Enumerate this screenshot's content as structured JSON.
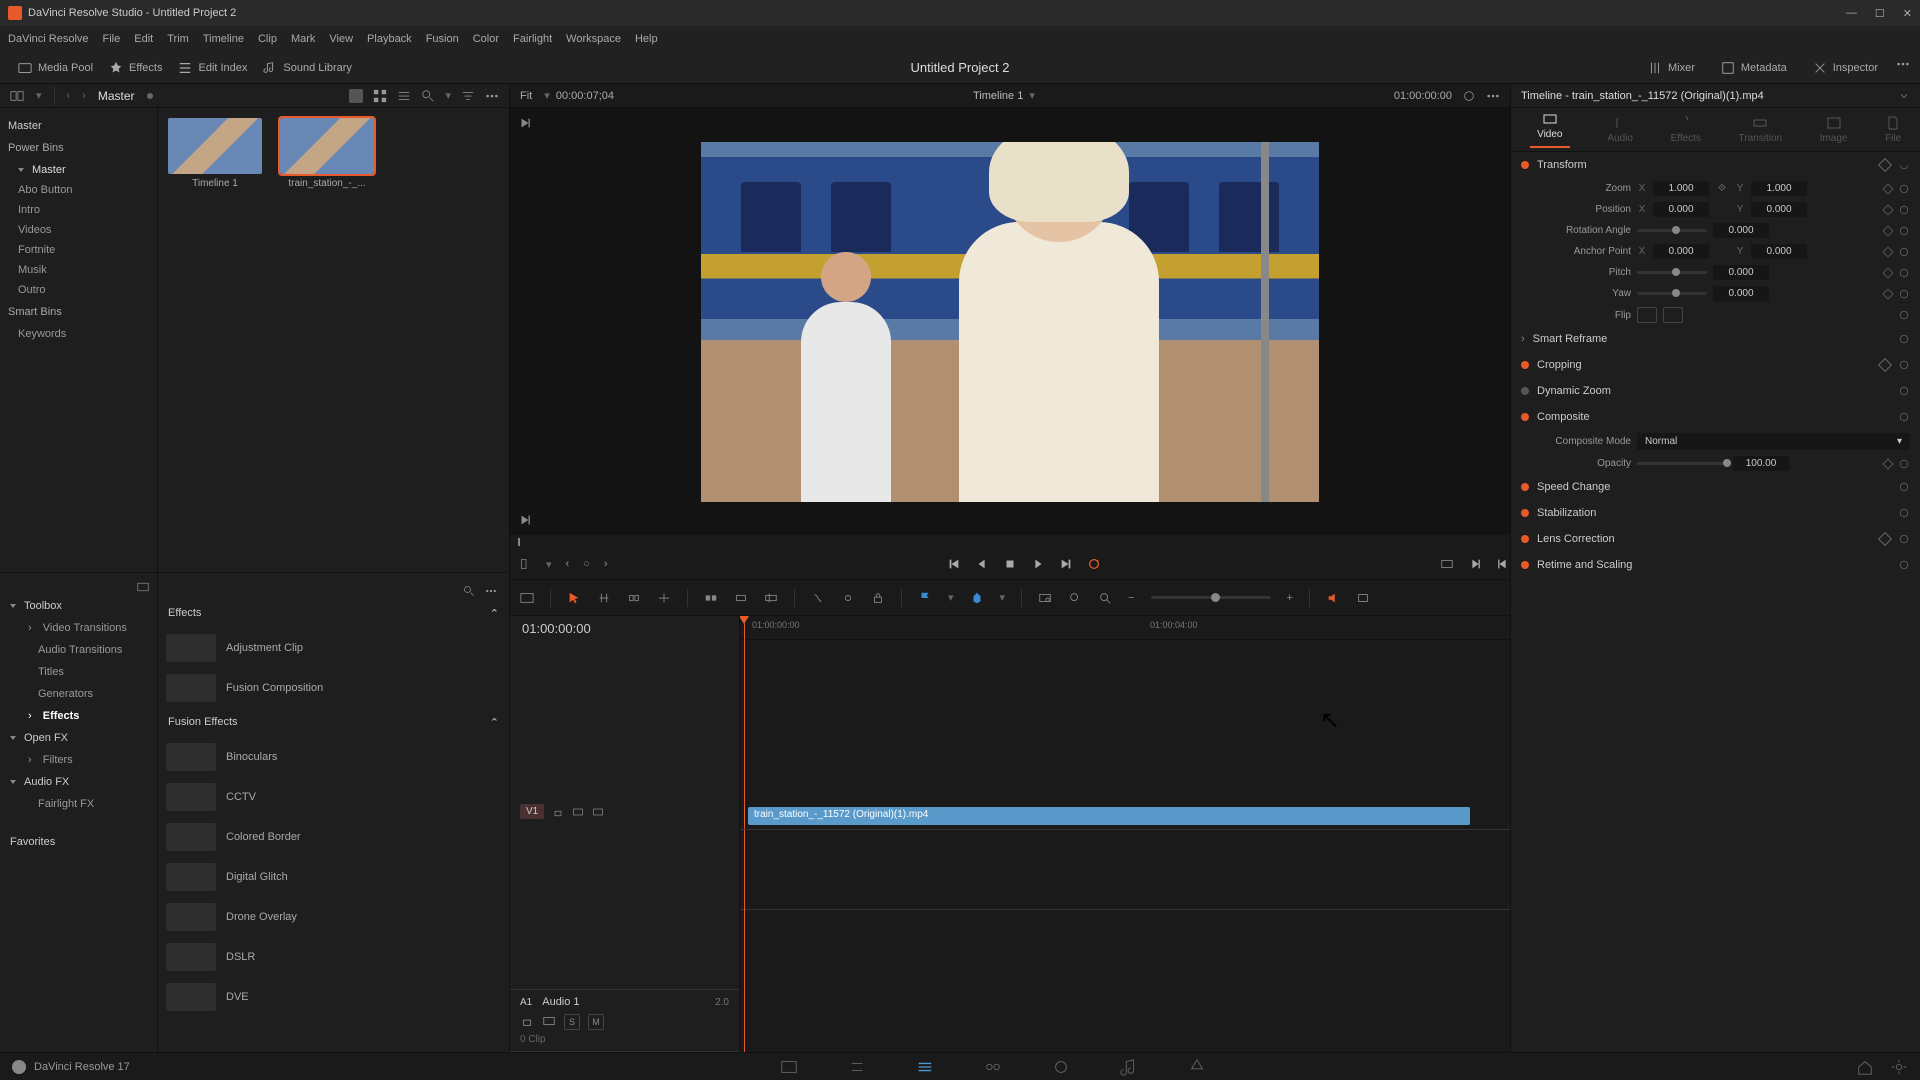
{
  "titlebar": {
    "text": "DaVinci Resolve Studio - Untitled Project 2"
  },
  "menubar": [
    "DaVinci Resolve",
    "File",
    "Edit",
    "Trim",
    "Timeline",
    "Clip",
    "Mark",
    "View",
    "Playback",
    "Fusion",
    "Color",
    "Fairlight",
    "Workspace",
    "Help"
  ],
  "toolbar": {
    "media_pool": "Media Pool",
    "effects": "Effects",
    "edit_index": "Edit Index",
    "sound_library": "Sound Library",
    "mixer": "Mixer",
    "metadata": "Metadata",
    "inspector": "Inspector",
    "project_title": "Untitled Project 2"
  },
  "media": {
    "master": "Master",
    "bins": {
      "master_root": "Master",
      "power_bins": "Power Bins",
      "power_master": "Master",
      "power_items": [
        "Abo Button",
        "Intro",
        "Videos",
        "Fortnite",
        "Musik",
        "Outro"
      ],
      "smart_bins": "Smart Bins",
      "keywords": "Keywords"
    },
    "clips": [
      {
        "name": "Timeline 1",
        "selected": false
      },
      {
        "name": "train_station_-_...",
        "selected": true
      }
    ]
  },
  "fx": {
    "nav": {
      "toolbox": "Toolbox",
      "toolbox_items": [
        "Video Transitions",
        "Audio Transitions",
        "Titles",
        "Generators",
        "Effects"
      ],
      "openfx": "Open FX",
      "openfx_items": [
        "Filters"
      ],
      "audiofx": "Audio FX",
      "audiofx_items": [
        "Fairlight FX"
      ],
      "favorites": "Favorites"
    },
    "groups": {
      "effects": "Effects",
      "effects_items": [
        "Adjustment Clip",
        "Fusion Composition"
      ],
      "fusion": "Fusion Effects",
      "fusion_items": [
        "Binoculars",
        "CCTV",
        "Colored Border",
        "Digital Glitch",
        "Drone Overlay",
        "DSLR",
        "DVE"
      ]
    }
  },
  "viewer": {
    "fit": "Fit",
    "timecode_left": "00:00:07;04",
    "timeline_name": "Timeline 1",
    "timecode_right": "01:00:00:00"
  },
  "timeline": {
    "head_tc": "01:00:00:00",
    "ruler_marks": [
      "01:00:00:00",
      "01:00:04:00"
    ],
    "v1": {
      "label": "V1"
    },
    "a1": {
      "label": "A1",
      "name": "Audio 1",
      "db": "2.0",
      "s": "S",
      "m": "M",
      "clips": "0 Clip"
    },
    "clip_name": "train_station_-_11572 (Original)(1).mp4"
  },
  "inspector": {
    "title": "Timeline - train_station_-_11572 (Original)(1).mp4",
    "tabs": [
      "Video",
      "Audio",
      "Effects",
      "Transition",
      "Image",
      "File"
    ],
    "transform": {
      "head": "Transform",
      "zoom": "Zoom",
      "zoom_x": "1.000",
      "zoom_y": "1.000",
      "position": "Position",
      "pos_x": "0.000",
      "pos_y": "0.000",
      "rotation": "Rotation Angle",
      "rotation_v": "0.000",
      "anchor": "Anchor Point",
      "anchor_x": "0.000",
      "anchor_y": "0.000",
      "pitch": "Pitch",
      "pitch_v": "0.000",
      "yaw": "Yaw",
      "yaw_v": "0.000",
      "flip": "Flip"
    },
    "smart_reframe": "Smart Reframe",
    "cropping": "Cropping",
    "dynamic_zoom": "Dynamic Zoom",
    "composite": {
      "head": "Composite",
      "mode_l": "Composite Mode",
      "mode_v": "Normal",
      "opacity_l": "Opacity",
      "opacity_v": "100.00"
    },
    "speed_change": "Speed Change",
    "stabilization": "Stabilization",
    "lens_correction": "Lens Correction",
    "retime": "Retime and Scaling"
  },
  "bottombar": {
    "version": "DaVinci Resolve 17"
  }
}
